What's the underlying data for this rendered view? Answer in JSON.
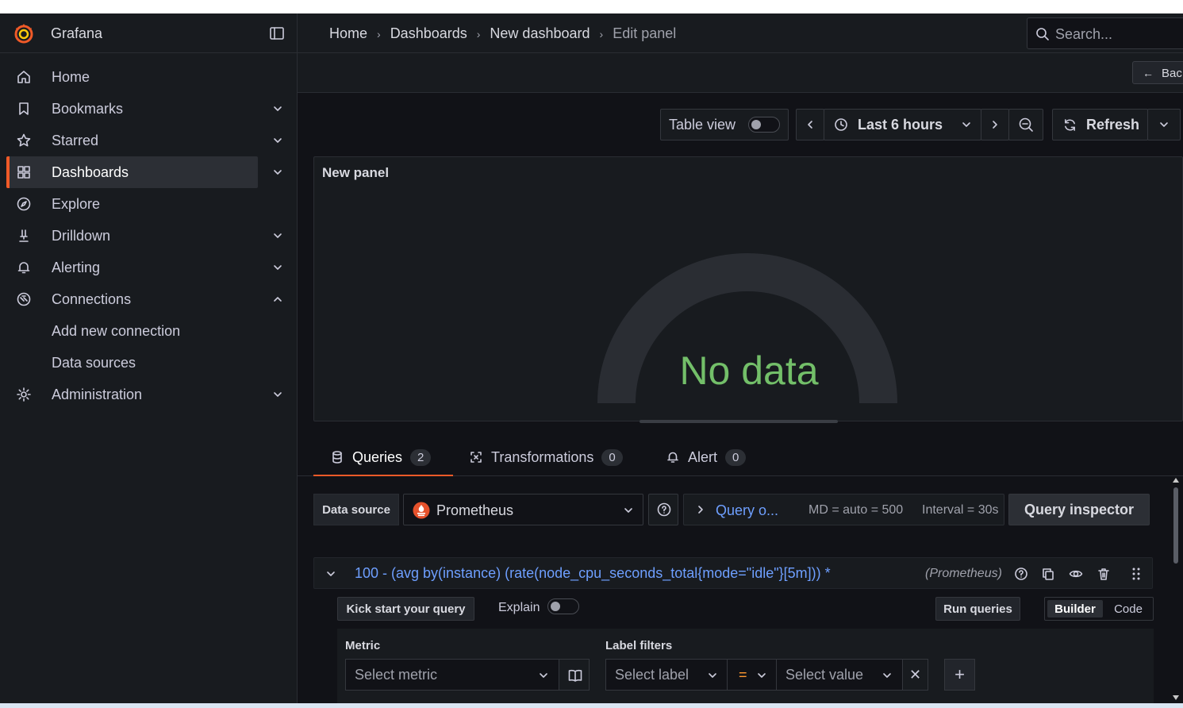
{
  "app": {
    "name": "Grafana"
  },
  "colors": {
    "accent": "#f05a28",
    "link": "#6e9fff",
    "nodata": "#73bf69",
    "operator": "#ff9830"
  },
  "sidebar": {
    "items": [
      {
        "label": "Home",
        "icon": "home-icon"
      },
      {
        "label": "Bookmarks",
        "icon": "bookmark-icon",
        "expandable": true
      },
      {
        "label": "Starred",
        "icon": "star-icon",
        "expandable": true
      },
      {
        "label": "Dashboards",
        "icon": "dashboards-grid-icon",
        "expandable": true,
        "active": true
      },
      {
        "label": "Explore",
        "icon": "compass-icon"
      },
      {
        "label": "Drilldown",
        "icon": "drilldown-icon",
        "expandable": true
      },
      {
        "label": "Alerting",
        "icon": "bell-icon",
        "expandable": true
      },
      {
        "label": "Connections",
        "icon": "connections-icon",
        "expanded": true
      },
      {
        "label": "Add new connection",
        "sub": true
      },
      {
        "label": "Data sources",
        "sub": true
      },
      {
        "label": "Administration",
        "icon": "gear-icon",
        "expandable": true
      }
    ]
  },
  "breadcrumbs": [
    "Home",
    "Dashboards",
    "New dashboard",
    "Edit panel"
  ],
  "search": {
    "placeholder": "Search..."
  },
  "back_button": {
    "label": "Bac"
  },
  "toolbar": {
    "table_view": "Table view",
    "time_range": "Last 6 hours",
    "refresh": "Refresh"
  },
  "panel": {
    "title": "New panel",
    "message": "No data"
  },
  "tabs": [
    {
      "label": "Queries",
      "count": "2",
      "icon": "database-icon"
    },
    {
      "label": "Transformations",
      "count": "0",
      "icon": "transform-icon"
    },
    {
      "label": "Alert",
      "count": "0",
      "icon": "bell-icon"
    }
  ],
  "datasource": {
    "label": "Data source",
    "selected": "Prometheus",
    "query_options": "Query o...",
    "max_data_points": "MD = auto = 500",
    "interval": "Interval = 30s",
    "inspector": "Query inspector"
  },
  "query": {
    "expression": "100 - (avg by(instance) (rate(node_cpu_seconds_total{mode=\"idle\"}[5m])) *",
    "source": "(Prometheus)",
    "kick_start": "Kick start your query",
    "explain": "Explain",
    "run": "Run queries",
    "mode_builder": "Builder",
    "mode_code": "Code"
  },
  "builder": {
    "metric_label": "Metric",
    "metric_placeholder": "Select metric",
    "label_filters_label": "Label filters",
    "label_placeholder": "Select label",
    "operator": "=",
    "value_placeholder": "Select value",
    "remove": "✕",
    "add": "+"
  }
}
